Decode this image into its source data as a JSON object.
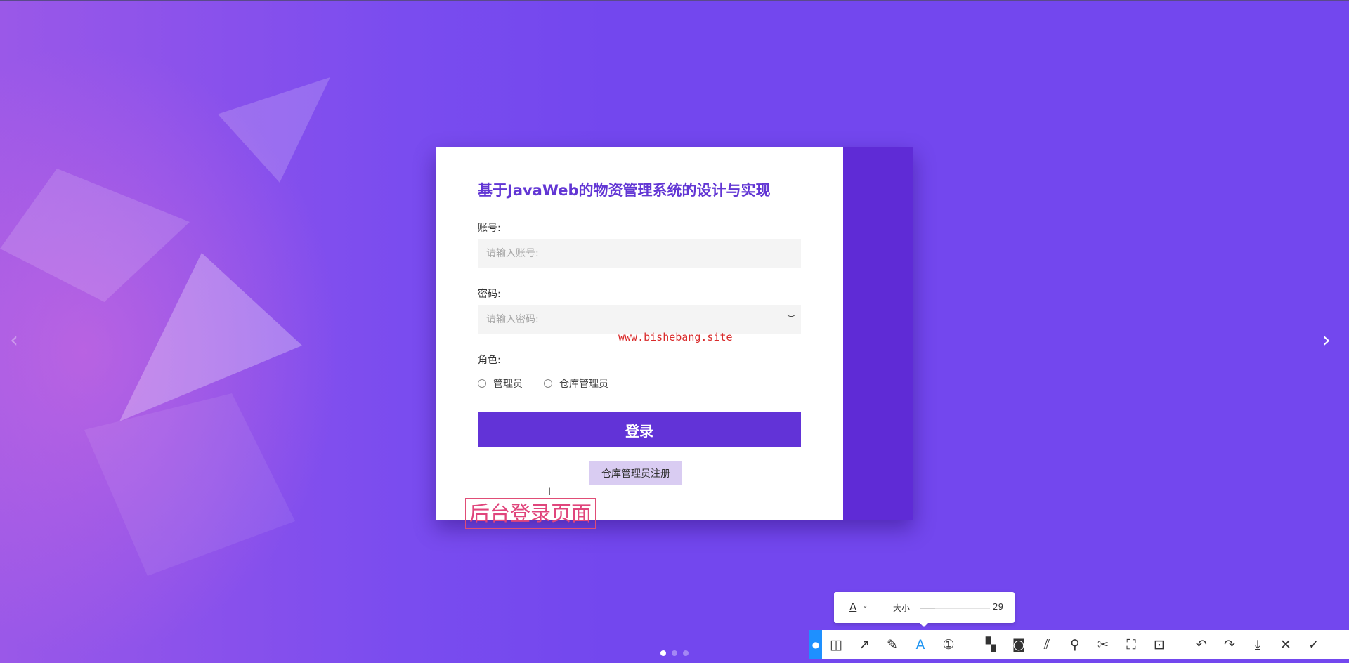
{
  "login": {
    "title": "基于JavaWeb的物资管理系统的设计与实现",
    "account_label": "账号:",
    "account_placeholder": "请输入账号:",
    "password_label": "密码:",
    "password_placeholder": "请输入密码:",
    "role_label": "角色:",
    "roles": [
      "管理员",
      "仓库管理员"
    ],
    "login_button": "登录",
    "register_button": "仓库管理员注册"
  },
  "watermark": "www.bishebang.site",
  "annotation_text": "后台登录页面",
  "size_panel": {
    "label": "大小",
    "value": "29"
  },
  "colors": {
    "background": "#7347ee",
    "accent": "#6233d7",
    "title": "#6236d4",
    "annotation": "#e0457c"
  },
  "carousel": {
    "slides": 3,
    "active": 1
  },
  "toolbar_icons": [
    "shape-icon",
    "arrow-icon",
    "pen-icon",
    "text-icon",
    "number-icon",
    "mosaic-icon",
    "blur-icon",
    "hatch-icon",
    "pin-icon",
    "scissors-icon",
    "translate-icon",
    "ocr-icon",
    "undo-icon",
    "redo-icon",
    "download-icon",
    "close-icon",
    "confirm-icon"
  ]
}
